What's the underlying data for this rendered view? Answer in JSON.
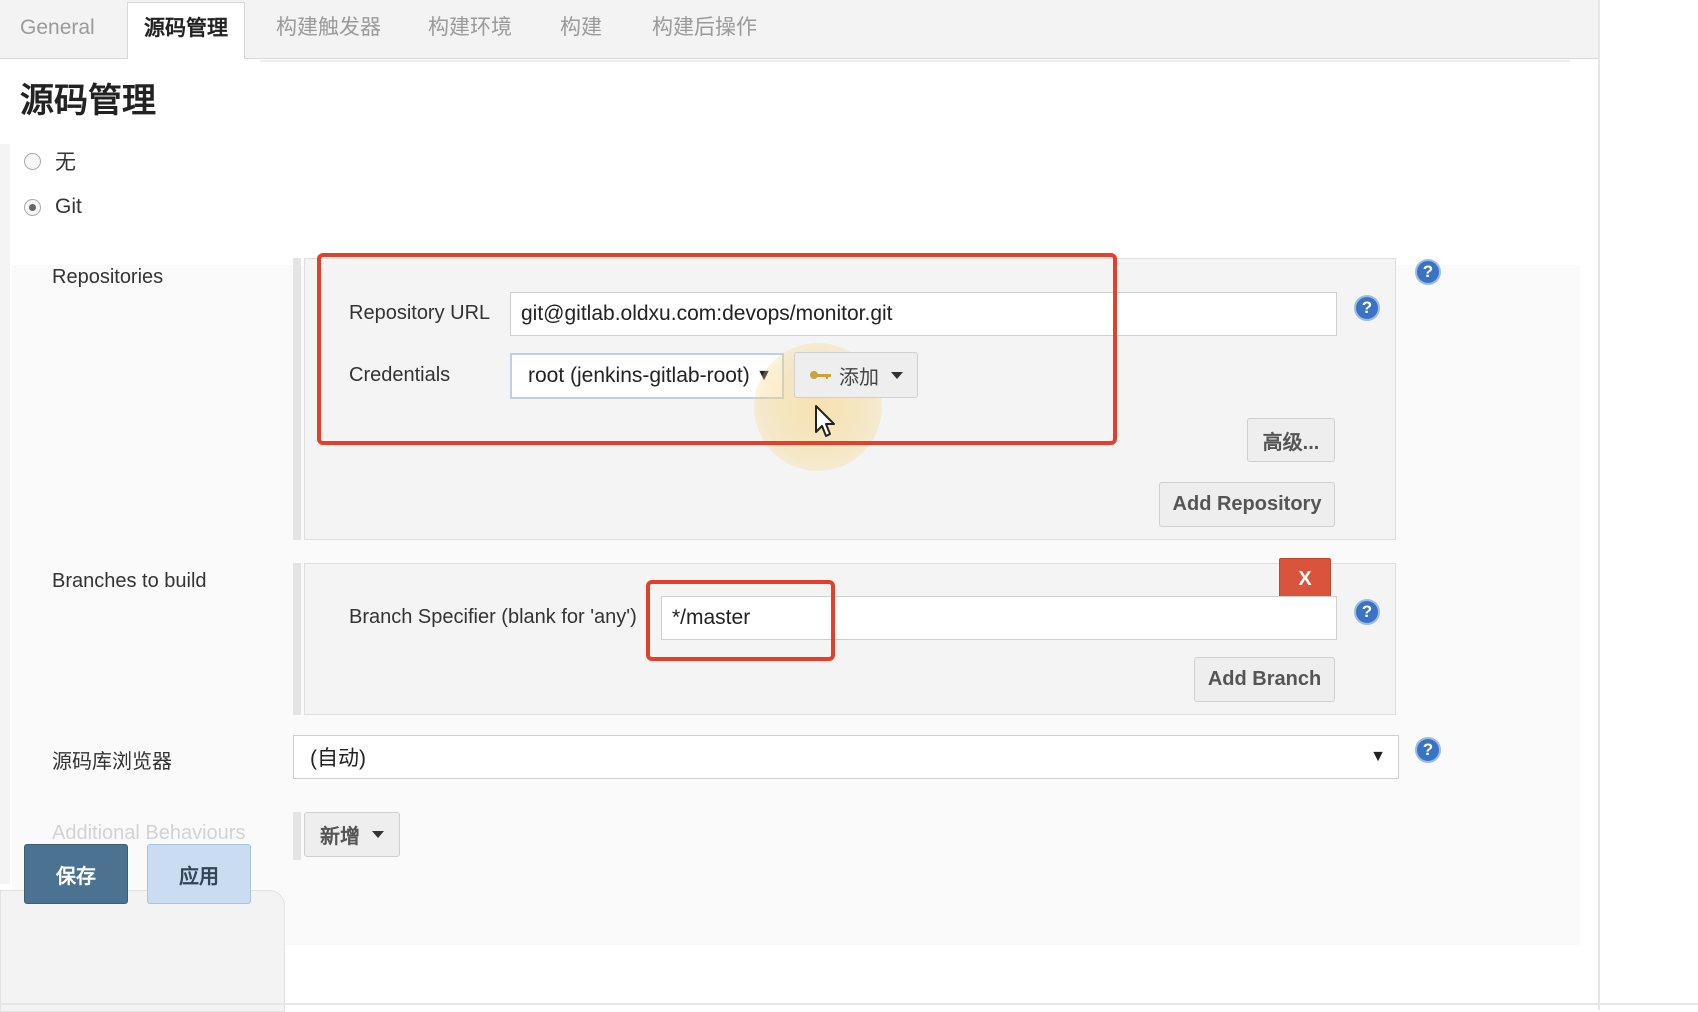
{
  "tabs": [
    {
      "label": "General"
    },
    {
      "label": "源码管理"
    },
    {
      "label": "构建触发器"
    },
    {
      "label": "构建环境"
    },
    {
      "label": "构建"
    },
    {
      "label": "构建后操作"
    }
  ],
  "active_tab": "源码管理",
  "section_title": "源码管理",
  "scm_options": {
    "none_label": "无",
    "git_label": "Git",
    "selected": "Git"
  },
  "repositories": {
    "label": "Repositories",
    "url_label": "Repository URL",
    "url_value": "git@gitlab.oldxu.com:devops/monitor.git",
    "credentials_label": "Credentials",
    "credentials_value": "root (jenkins-gitlab-root)",
    "add_button": "添加",
    "advanced_button": "高级...",
    "add_repository_button": "Add Repository"
  },
  "branches": {
    "label": "Branches to build",
    "specifier_label": "Branch Specifier (blank for 'any')",
    "specifier_value": "*/master",
    "delete_button": "X",
    "add_branch_button": "Add Branch"
  },
  "repo_browser": {
    "label": "源码库浏览器",
    "value": "(自动)"
  },
  "additional_behaviours": {
    "label": "Additional Behaviours",
    "add_button": "新增"
  },
  "footer": {
    "save_button": "保存",
    "apply_button": "应用"
  },
  "help_icon_text": "?",
  "colors": {
    "highlight": "#e2402a",
    "help_icon": "#3a73c2",
    "delete_button": "#d9533d",
    "save_button": "#4b7391",
    "apply_button": "#c9dcf0"
  }
}
